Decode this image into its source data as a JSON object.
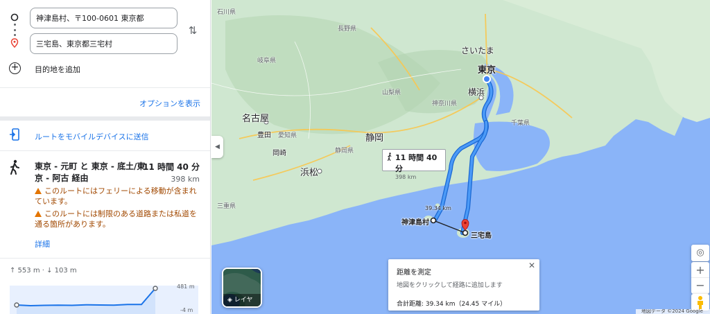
{
  "directions": {
    "origin": "神津島村、〒100-0601 東京都",
    "destination": "三宅島、東京都三宅村",
    "add_destination": "目的地を追加",
    "show_options": "オプションを表示",
    "send_to_mobile": "ルートをモバイルデバイスに送信"
  },
  "route": {
    "title": "東京 - 元町 と 東京 - 底土/東京 - 阿古 経由",
    "duration": "11 時間 40 分",
    "distance": "398 km",
    "warnings": [
      "このルートにはフェリーによる移動が含まれています。",
      "このルートには制限のある道路または私道を通る箇所があります。"
    ],
    "details_link": "詳細"
  },
  "elevation": {
    "summary": "↑ 553 m · ↓ 103 m",
    "max_label": "481 m",
    "min_label": "-4 m",
    "profile": [
      0.04,
      0.0,
      0.02,
      0.03,
      0.02,
      0.05,
      0.04,
      0.03,
      0.07,
      0.07,
      1.0
    ]
  },
  "map": {
    "prefectures": [
      "石川県",
      "長野県",
      "岐阜県",
      "山梨県",
      "神奈川県",
      "千葉県",
      "静岡県",
      "愛知県",
      "三重県"
    ],
    "cities": [
      "さいたま",
      "東京",
      "横浜",
      "名古屋",
      "豊田",
      "岡崎",
      "静岡",
      "浜松"
    ],
    "islands": [
      "神津島村",
      "三宅島"
    ],
    "tooltip": {
      "duration": "11 時間 40 分",
      "distance": "398 km"
    },
    "measure_line_label": "39.34 km",
    "measure": {
      "title": "距離を測定",
      "hint": "地図をクリックして経路に追加します",
      "total": "合計距離: 39.34 km（24.45 マイル）"
    },
    "layers_label": "レイヤ",
    "footer": "地図データ ©2024 Google",
    "colors": {
      "water": "#8ab4f8",
      "land": "#cfe7d0",
      "route": "#1a73e8",
      "destination_pin": "#ea4335",
      "link": "#1a73e8"
    }
  },
  "icons": [
    "origin-circle-icon",
    "destination-pin-icon",
    "swap-icon",
    "add-icon",
    "send-device-icon",
    "walk-icon",
    "warning-icon",
    "location-icon",
    "zoom-in-icon",
    "zoom-out-icon",
    "pegman-icon",
    "layers-icon",
    "close-icon"
  ]
}
